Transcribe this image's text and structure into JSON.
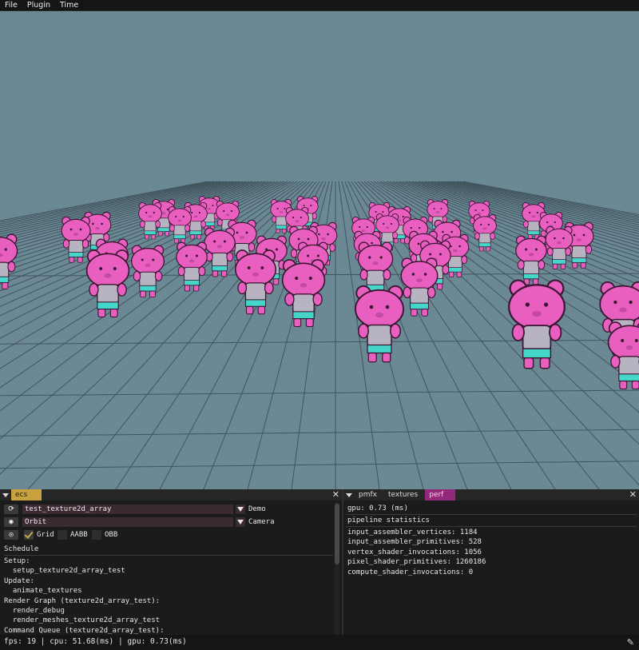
{
  "menu": {
    "items": [
      "File",
      "Plugin",
      "Time"
    ]
  },
  "colors": {
    "sky": "#6b8895",
    "grid_line": "#3d4f58",
    "bear_pink": "#e85fc0",
    "bear_shirt": "#b8b3c0",
    "bear_shorts": "#44d6c9",
    "accent_gold": "#c9a23f",
    "accent_purple": "#93277a"
  },
  "viewport": {
    "scene": "instanced pink bear sprites on grid"
  },
  "left_panel": {
    "tabs": [
      {
        "label": "ecs",
        "active": true
      }
    ],
    "demo": {
      "value": "test_texture2d_array",
      "label": "Demo",
      "icon": "refresh-icon"
    },
    "camera": {
      "value": "Orbit",
      "label": "Camera",
      "icon": "camera-icon"
    },
    "toggles": {
      "icon": "eye-icon",
      "grid": "Grid",
      "aabb": "AABB",
      "obb": "OBB",
      "grid_on": true,
      "aabb_on": false,
      "obb_on": false
    },
    "schedule_title": "Schedule",
    "lines": [
      "Setup:",
      "  setup_texture2d_array_test",
      "Update:",
      "  animate_textures",
      "Render Graph (texture2d_array_test):",
      "  render_debug",
      "  render_meshes_texture2d_array_test",
      "Command Queue (texture2d_array_test):"
    ]
  },
  "right_panel": {
    "tabs": [
      {
        "label": "pmfx"
      },
      {
        "label": "textures"
      },
      {
        "label": "perf",
        "active": true
      }
    ],
    "gpu": "gpu: 0.73 (ms)",
    "stats_title": "pipeline statistics",
    "stats": [
      "input_assembler_vertices: 1184",
      "input_assembler_primitives: 528",
      "vertex_shader_invocations: 1056",
      "pixel_shader_primitives: 1260186",
      "compute_shader_invocations: 0"
    ]
  },
  "status": {
    "text": "fps: 19 | cpu: 51.68(ms) | gpu: 0.73(ms)"
  }
}
